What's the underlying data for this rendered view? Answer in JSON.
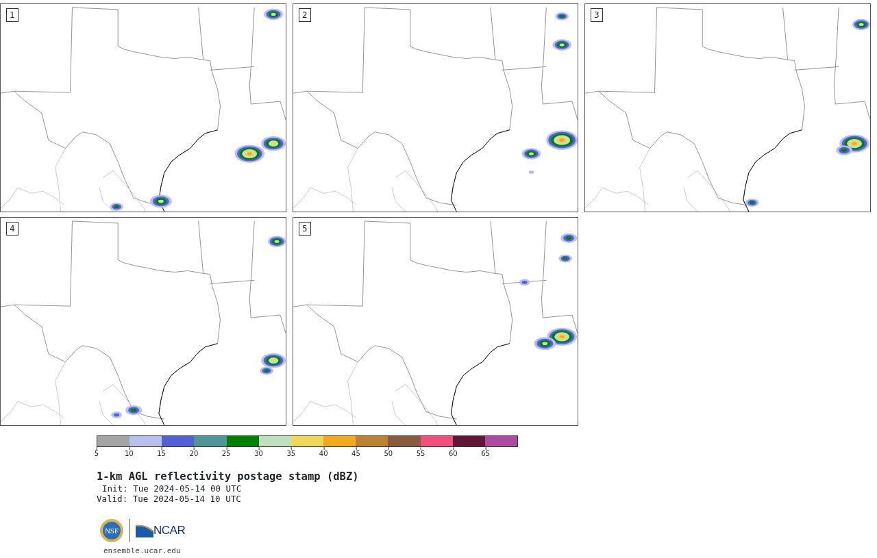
{
  "panels": [
    {
      "label": "1"
    },
    {
      "label": "2"
    },
    {
      "label": "3"
    },
    {
      "label": "4"
    },
    {
      "label": "5"
    }
  ],
  "colorbar": {
    "segments": [
      {
        "color": "#a5a5a5"
      },
      {
        "color": "#b8c1ec"
      },
      {
        "color": "#5461d6"
      },
      {
        "color": "#509698"
      },
      {
        "color": "#008000"
      },
      {
        "color": "#bfdfbf"
      },
      {
        "color": "#eed85c"
      },
      {
        "color": "#f0aa1c"
      },
      {
        "color": "#bb8433"
      },
      {
        "color": "#8a5a3e"
      },
      {
        "color": "#f24f7c"
      },
      {
        "color": "#621635"
      },
      {
        "color": "#ac4aa2"
      }
    ],
    "tick_labels": [
      "5",
      "10",
      "15",
      "20",
      "25",
      "30",
      "35",
      "40",
      "45",
      "50",
      "55",
      "60",
      "65"
    ]
  },
  "title": "1-km AGL reflectivity postage stamp (dBZ)",
  "init": "Init: Tue 2024-05-14 00 UTC",
  "valid": "Valid: Tue 2024-05-14 10 UTC",
  "logos": {
    "nsf_text": "NSF",
    "ncar_text": "NCAR"
  },
  "footer_url": "ensemble.ucar.edu"
}
